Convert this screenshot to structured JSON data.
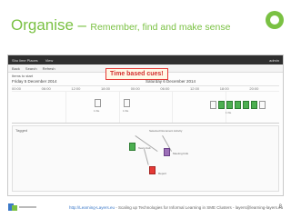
{
  "slide": {
    "title_main": "Organise",
    "title_dash": "–",
    "title_sub": "Remember, find and make sense",
    "page_number": "8",
    "brand_color": "#7ac143"
  },
  "app": {
    "topbar_left": "Sho lime Places",
    "topbar_menu": "View",
    "topbar_right": "admin",
    "toolbar_items": [
      "Back",
      "Search",
      "Refresh"
    ],
    "timeline_label": "Items to start",
    "days": [
      "Friday 5 December 2014",
      "Saturday 6 December 2014"
    ],
    "hours": [
      "00:00",
      "06:00",
      "12:00",
      "18:00",
      "00:00",
      "06:00",
      "12:00",
      "18:00",
      "20:00"
    ],
    "annotation": "Time based cues!",
    "lower_label": "Tagged",
    "cluster_caption": "Selected Document Activity",
    "documents": [
      {
        "cap": "1 file"
      },
      {
        "cap": "1 file"
      },
      {
        "cap": "1 file"
      },
      {
        "cap": "Team Cult"
      },
      {
        "cap": "Meeting bids"
      },
      {
        "cap": "Report"
      }
    ]
  },
  "footer": {
    "link": "http://Learning-Layers.eu",
    "text": " - Scaling up Technologies for Informal Learning in SME Clusters - layers@learning-layers.eu"
  }
}
